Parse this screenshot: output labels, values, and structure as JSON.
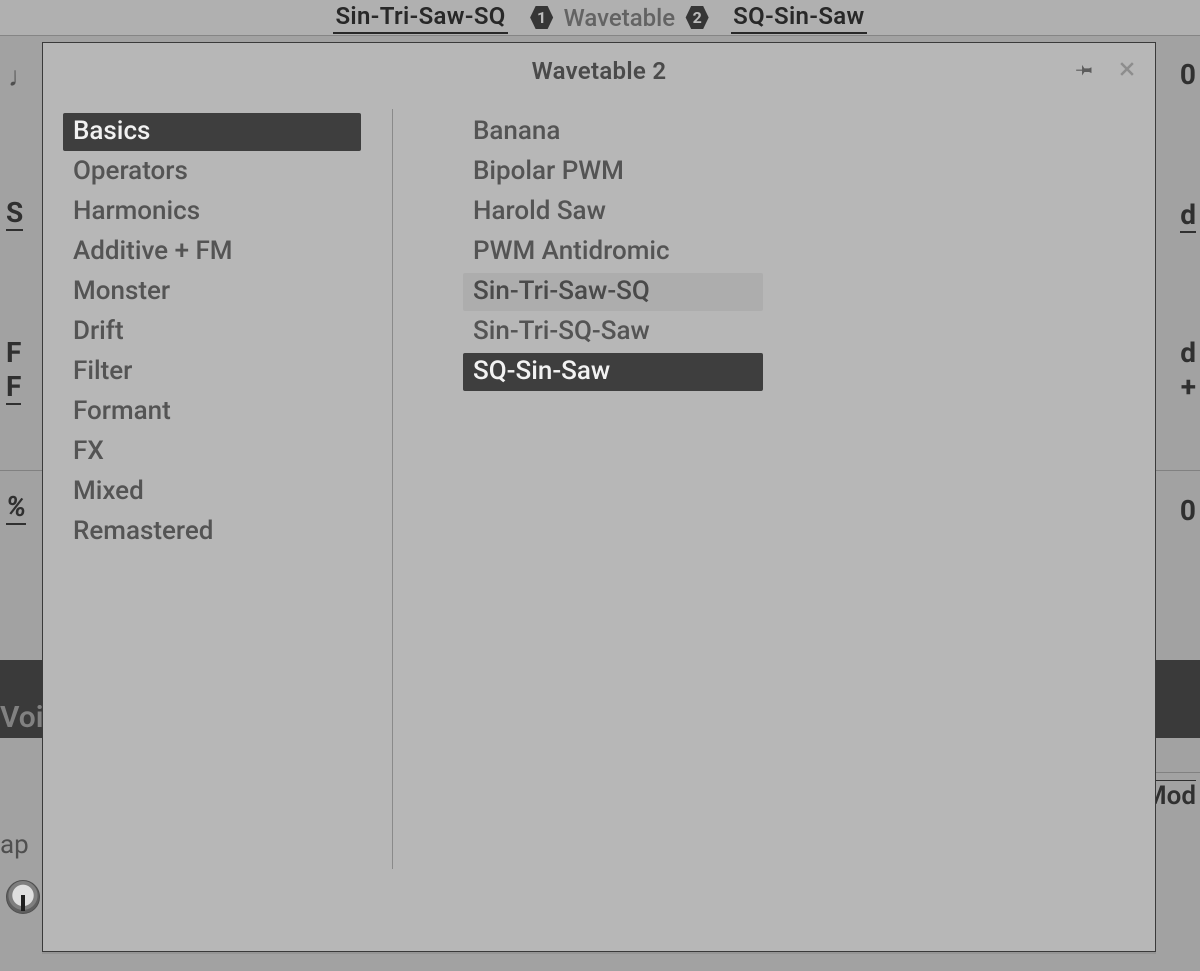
{
  "top_tabs": {
    "left_label": "Sin-Tri-Saw-SQ",
    "center_label": "Wavetable",
    "badge_1": "1",
    "badge_2": "2",
    "right_label": "SQ-Sin-Saw"
  },
  "popup": {
    "title": "Wavetable 2",
    "pin_icon": "pin-icon",
    "close_icon": "close-icon",
    "categories": [
      {
        "label": "Basics",
        "active": true
      },
      {
        "label": "Operators",
        "active": false
      },
      {
        "label": "Harmonics",
        "active": false
      },
      {
        "label": "Additive + FM",
        "active": false
      },
      {
        "label": "Monster",
        "active": false
      },
      {
        "label": "Drift",
        "active": false
      },
      {
        "label": "Filter",
        "active": false
      },
      {
        "label": "Formant",
        "active": false
      },
      {
        "label": "FX",
        "active": false
      },
      {
        "label": "Mixed",
        "active": false
      },
      {
        "label": "Remastered",
        "active": false
      }
    ],
    "presets": [
      {
        "label": "Banana",
        "state": "normal"
      },
      {
        "label": "Bipolar PWM",
        "state": "normal"
      },
      {
        "label": "Harold Saw",
        "state": "normal"
      },
      {
        "label": "PWM Antidromic",
        "state": "normal"
      },
      {
        "label": "Sin-Tri-Saw-SQ",
        "state": "highlight"
      },
      {
        "label": "Sin-Tri-SQ-Saw",
        "state": "normal"
      },
      {
        "label": "SQ-Sin-Saw",
        "state": "active"
      }
    ]
  },
  "background": {
    "side_s": "S",
    "side_f": "F",
    "side_f2": "F",
    "pct": "%",
    "zero_top": "0",
    "d": "d",
    "dplus": "d",
    "plus": "+",
    "zero_bot": "0",
    "voi": "Voi",
    "mod": "Mod",
    "ap": "ap"
  }
}
